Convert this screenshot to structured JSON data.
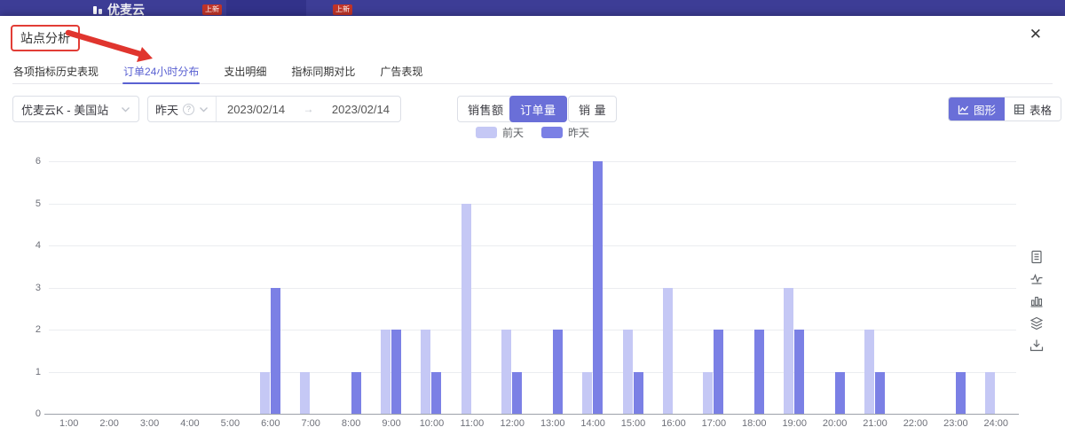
{
  "header": {
    "logo": "优麦云",
    "badge1": "上新",
    "badge2": "上新"
  },
  "modal": {
    "title": "站点分析"
  },
  "icons": {
    "close": "✕",
    "question": "?",
    "range_arrow": "→"
  },
  "tabs": {
    "items": [
      {
        "label": "各项指标历史表现",
        "active": false
      },
      {
        "label": "订单24小时分布",
        "active": true
      },
      {
        "label": "支出明细",
        "active": false
      },
      {
        "label": "指标同期对比",
        "active": false
      },
      {
        "label": "广告表现",
        "active": false
      }
    ]
  },
  "filters": {
    "site": "优麦云K - 美国站",
    "period": "昨天",
    "date_start": "2023/02/14",
    "date_end": "2023/02/14"
  },
  "metrics": {
    "sales": "销售额",
    "orders": "订单量",
    "volume": "销 量",
    "selected": "订单量"
  },
  "view_toggle": {
    "chart_label": "图形",
    "table_label": "表格",
    "selected": "图形"
  },
  "colors": {
    "accent": "#6a6fd8",
    "tab_active": "#5a61d2",
    "annotation_red": "#e0352e",
    "topbar": "#3d3d96",
    "badge_red": "#c23428",
    "bar_prev": "#c5c8f5",
    "bar_yday": "#7b80e5"
  },
  "chart_data": {
    "type": "bar",
    "title": "",
    "xlabel": "",
    "ylabel": "",
    "ylim": [
      0,
      6
    ],
    "yticks": [
      0,
      1,
      2,
      3,
      4,
      5,
      6
    ],
    "grid": true,
    "legend_position": "top-center",
    "categories": [
      "1:00",
      "2:00",
      "3:00",
      "4:00",
      "5:00",
      "6:00",
      "7:00",
      "8:00",
      "9:00",
      "10:00",
      "11:00",
      "12:00",
      "13:00",
      "14:00",
      "15:00",
      "16:00",
      "17:00",
      "18:00",
      "19:00",
      "20:00",
      "21:00",
      "22:00",
      "23:00",
      "24:00"
    ],
    "series": [
      {
        "name": "前天",
        "color": "#c5c8f5",
        "values": [
          0,
          0,
          0,
          0,
          0,
          1,
          1,
          0,
          2,
          2,
          5,
          2,
          0,
          1,
          2,
          3,
          1,
          0,
          3,
          0,
          2,
          0,
          0,
          1
        ]
      },
      {
        "name": "昨天",
        "color": "#7b80e5",
        "values": [
          0,
          0,
          0,
          0,
          0,
          3,
          0,
          1,
          2,
          1,
          0,
          1,
          2,
          6,
          1,
          0,
          2,
          2,
          2,
          1,
          1,
          0,
          1,
          0
        ]
      }
    ]
  }
}
